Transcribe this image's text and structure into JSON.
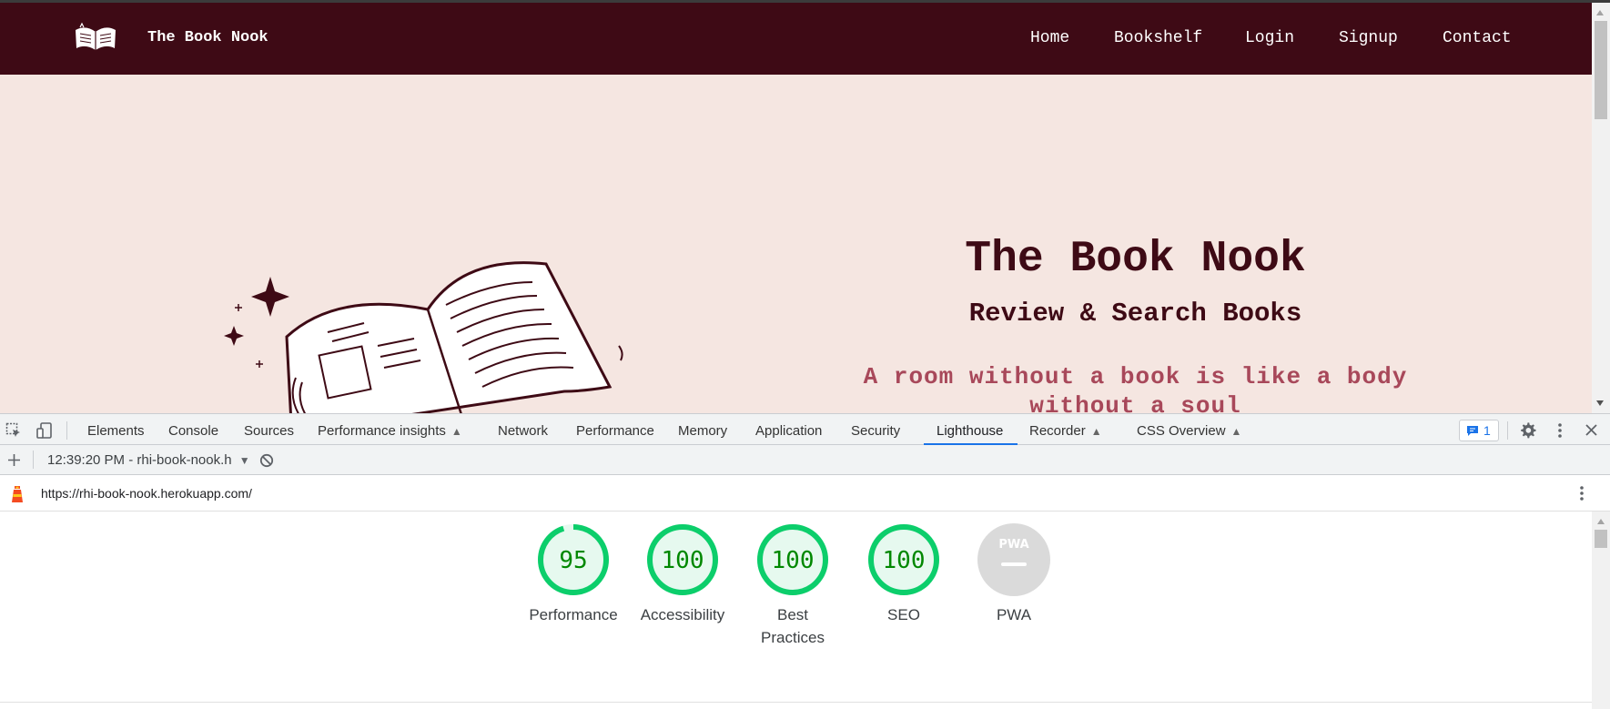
{
  "site": {
    "brand": "The Book Nook",
    "nav": [
      "Home",
      "Bookshelf",
      "Login",
      "Signup",
      "Contact"
    ],
    "hero": {
      "title": "The Book Nook",
      "subtitle": "Review & Search Books",
      "quote": "A room without a book is like a body without a soul"
    },
    "colors": {
      "navbar": "#3e0a15",
      "background": "#f5e6e1",
      "quote": "#a8485a"
    }
  },
  "devtools": {
    "tabs": [
      {
        "label": "Elements",
        "experimental": false
      },
      {
        "label": "Console",
        "experimental": false
      },
      {
        "label": "Sources",
        "experimental": false
      },
      {
        "label": "Performance insights",
        "experimental": true
      },
      {
        "label": "Network",
        "experimental": false
      },
      {
        "label": "Performance",
        "experimental": false
      },
      {
        "label": "Memory",
        "experimental": false
      },
      {
        "label": "Application",
        "experimental": false
      },
      {
        "label": "Security",
        "experimental": false
      },
      {
        "label": "Lighthouse",
        "experimental": false
      },
      {
        "label": "Recorder",
        "experimental": true
      },
      {
        "label": "CSS Overview",
        "experimental": true
      }
    ],
    "active_tab": "Lighthouse",
    "issues_count": "1",
    "report_selector": "12:39:20 PM - rhi-book-nook.h",
    "url": "https://rhi-book-nook.herokuapp.com/"
  },
  "lighthouse": {
    "scores": [
      {
        "category": "Performance",
        "score": "95",
        "fraction": 0.95
      },
      {
        "category": "Accessibility",
        "score": "100",
        "fraction": 1.0
      },
      {
        "category": "Best Practices",
        "score": "100",
        "fraction": 1.0
      },
      {
        "category": "SEO",
        "score": "100",
        "fraction": 1.0
      },
      {
        "category": "PWA",
        "score": "",
        "fraction": 0
      }
    ],
    "pwa_badge": "PWA",
    "colors": {
      "pass": "#0cce6b",
      "pass_text": "#008800",
      "pass_fill": "#e6f9ef",
      "na": "#dadada"
    }
  }
}
